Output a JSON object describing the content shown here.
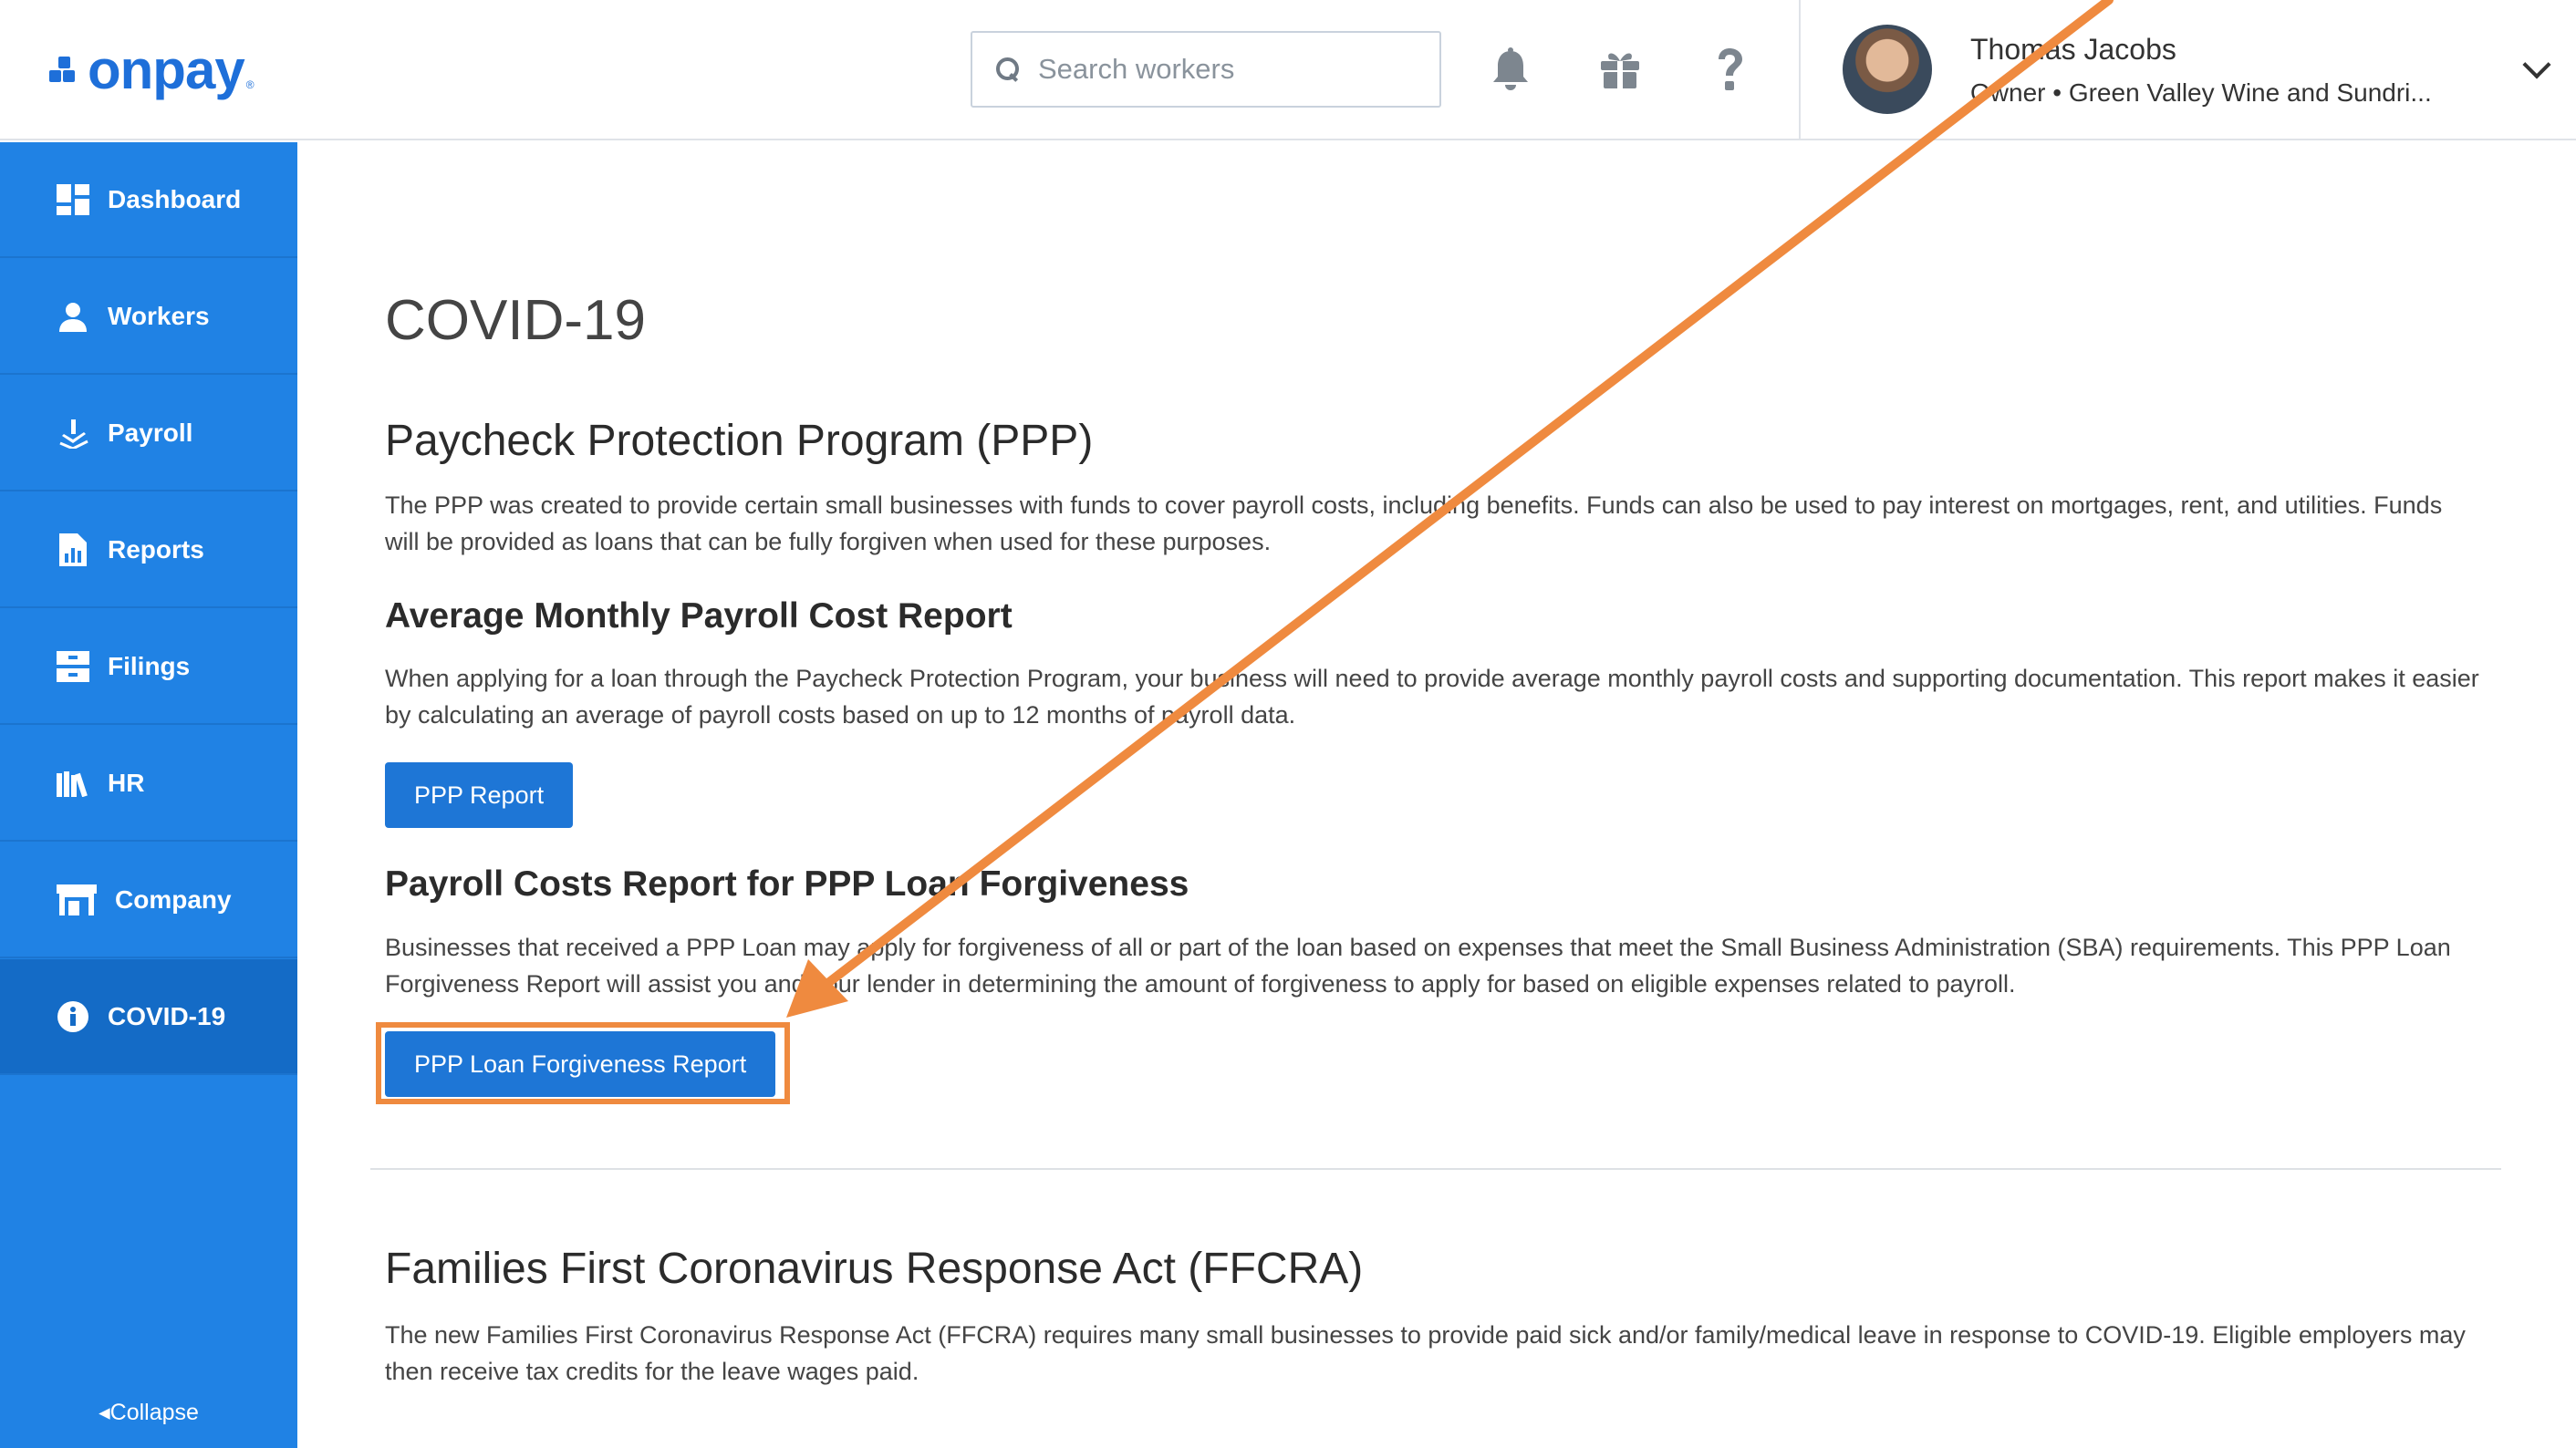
{
  "header": {
    "logo_text": "onpay",
    "logo_reg": "®",
    "search_placeholder": "Search workers",
    "icons": [
      "bell-icon",
      "gift-icon",
      "help-icon"
    ],
    "user": {
      "name": "Thomas Jacobs",
      "role": "Owner • Green Valley Wine and Sundri..."
    }
  },
  "sidebar": {
    "items": [
      {
        "label": "Dashboard",
        "icon": "dashboard-icon"
      },
      {
        "label": "Workers",
        "icon": "workers-icon"
      },
      {
        "label": "Payroll",
        "icon": "payroll-icon"
      },
      {
        "label": "Reports",
        "icon": "reports-icon"
      },
      {
        "label": "Filings",
        "icon": "filings-icon"
      },
      {
        "label": "HR",
        "icon": "hr-icon"
      },
      {
        "label": "Company",
        "icon": "company-icon"
      },
      {
        "label": "COVID-19",
        "icon": "info-icon",
        "active": true
      }
    ],
    "collapse_label": "Collapse"
  },
  "main": {
    "title": "COVID-19",
    "ppp": {
      "heading": "Paycheck Protection Program (PPP)",
      "text": "The PPP was created to provide certain small businesses with funds to cover payroll costs, including benefits. Funds can also be used to pay interest on mortgages, rent, and utilities. Funds will be provided as loans that can be fully forgiven when used for these purposes."
    },
    "avg_report": {
      "heading": "Average Monthly Payroll Cost Report",
      "text": "When applying for a loan through the Paycheck Protection Program, your business will need to provide average monthly payroll costs and supporting documentation. This report makes it easier by calculating an average of payroll costs based on up to 12 months of payroll data.",
      "button": "PPP Report"
    },
    "forgiveness": {
      "heading": "Payroll Costs Report for PPP Loan Forgiveness",
      "text": "Businesses that received a PPP Loan may apply for forgiveness of all or part of the loan based on expenses that meet the Small Business Administration (SBA) requirements. This PPP Loan Forgiveness Report will assist you and your lender in determining the amount of forgiveness to apply for based on eligible expenses related to payroll.",
      "button": "PPP Loan Forgiveness Report"
    },
    "ffcra": {
      "heading": "Families First Coronavirus Response Act (FFCRA)",
      "text": "The new Families First Coronavirus Response Act (FFCRA) requires many small businesses to provide paid sick and/or family/medical leave in response to COVID-19. Eligible employers may then receive tax credits for the leave wages paid."
    }
  },
  "colors": {
    "brand": "#1e6fd9",
    "sidebar": "#2082e4",
    "sidebar_active": "#146bc6",
    "button": "#1e76d6",
    "annotation": "#ef8a3f"
  }
}
